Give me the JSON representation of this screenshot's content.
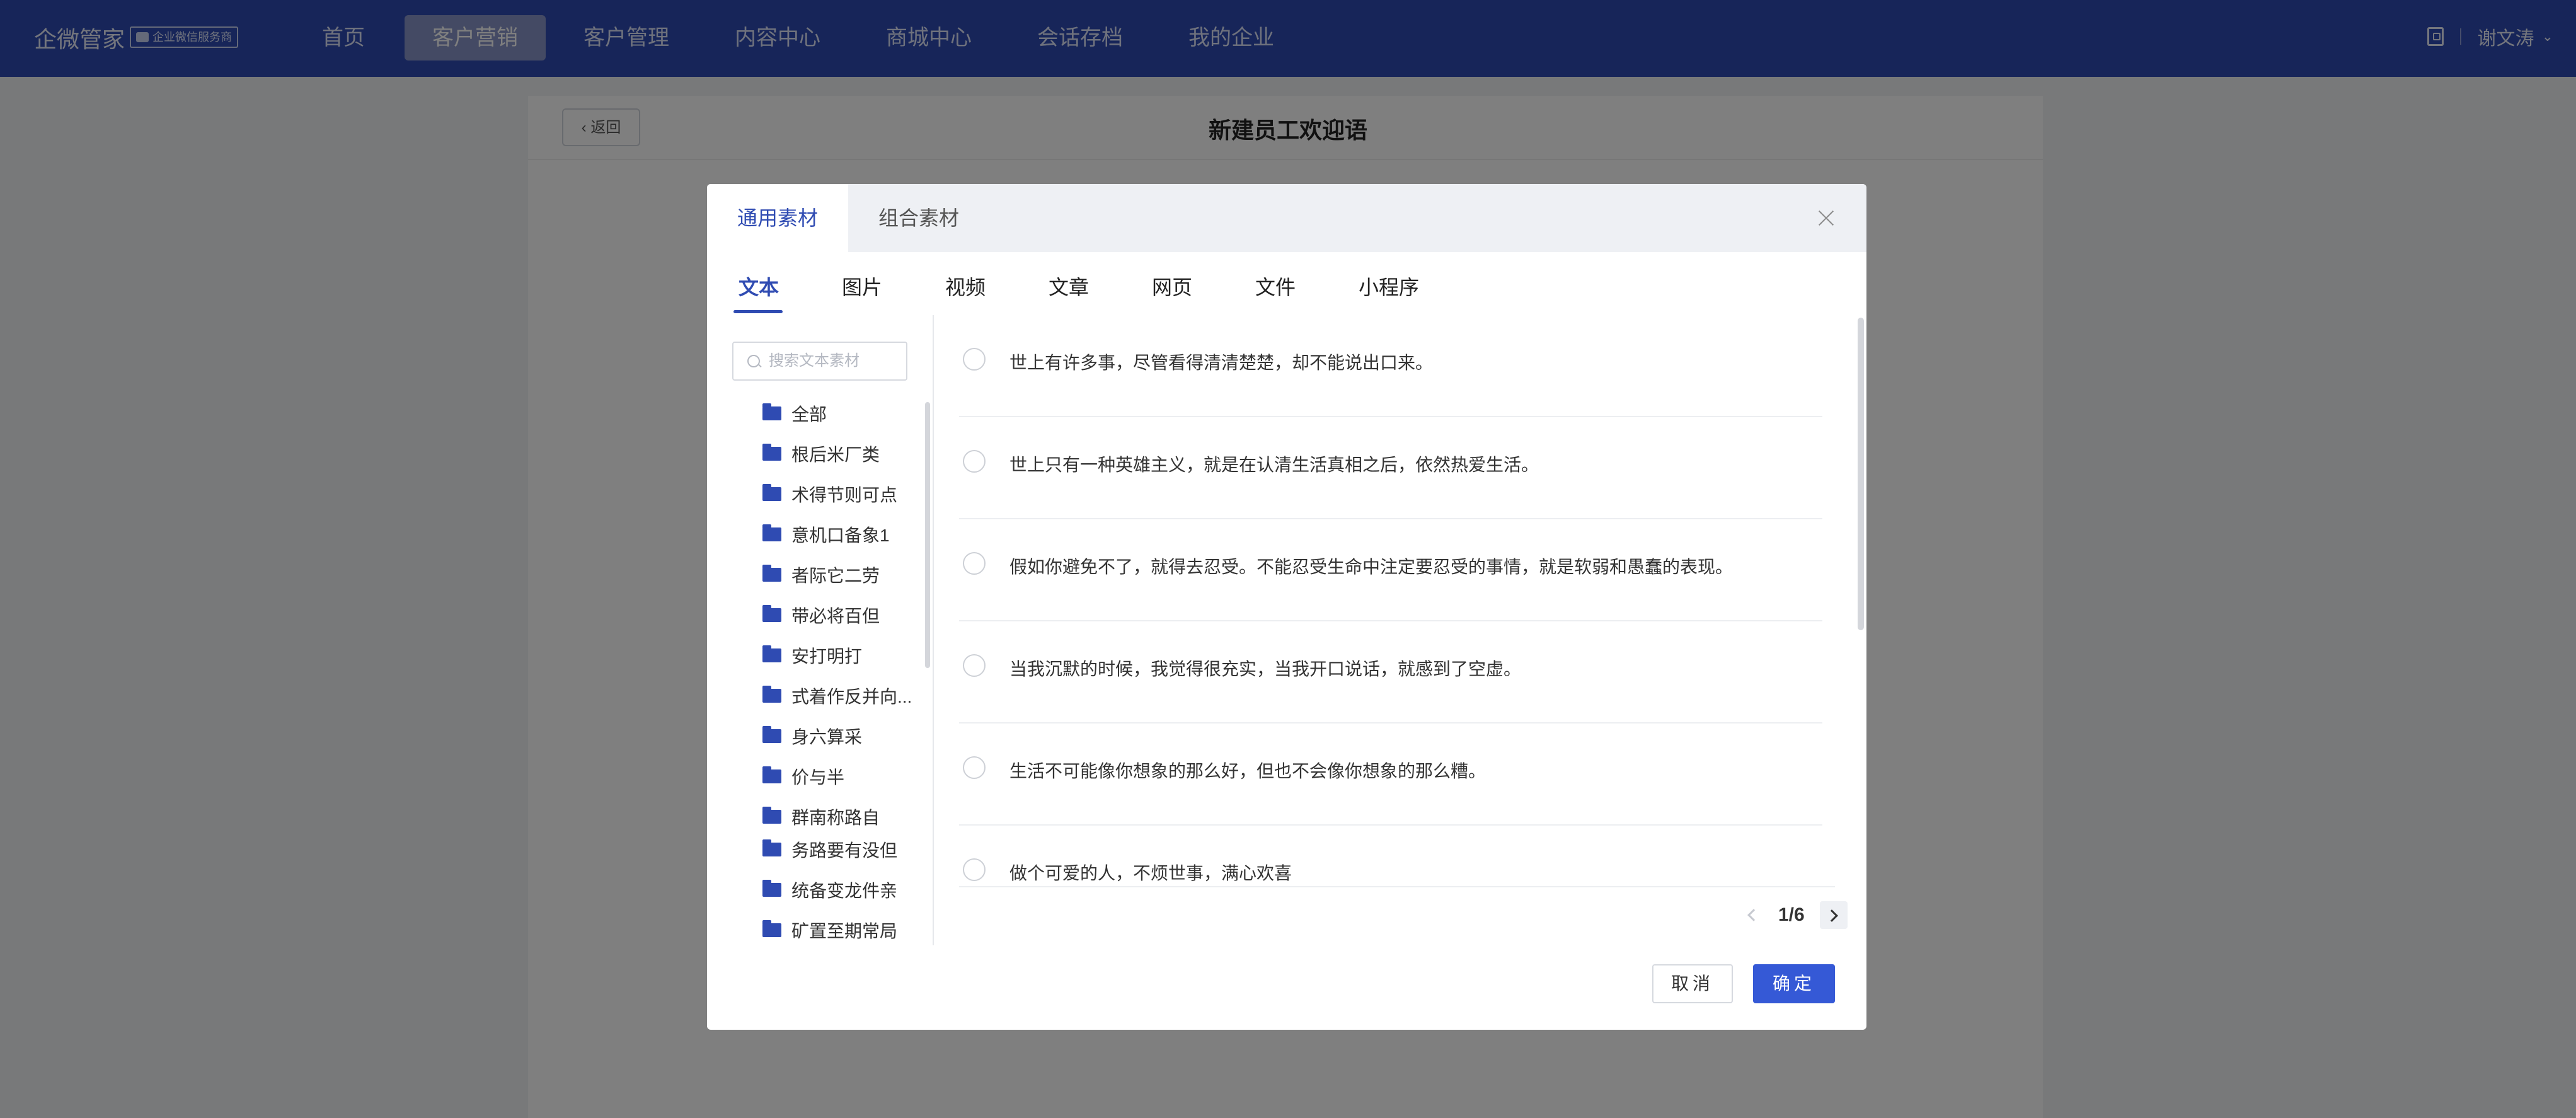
{
  "topbar": {
    "logo": "企微管家",
    "badge": "企业微信服务商",
    "nav": [
      {
        "label": "首页"
      },
      {
        "label": "客户营销"
      },
      {
        "label": "客户管理"
      },
      {
        "label": "内容中心"
      },
      {
        "label": "商城中心"
      },
      {
        "label": "会话存档"
      },
      {
        "label": "我的企业"
      }
    ],
    "active_nav": "客户营销",
    "user": "谢文涛"
  },
  "page": {
    "back_label": "返回",
    "title": "新建员工欢迎语"
  },
  "modal": {
    "tabs": [
      {
        "label": "通用素材"
      },
      {
        "label": "组合素材"
      }
    ],
    "active_tab": "通用素材",
    "content_tabs": [
      {
        "label": "文本"
      },
      {
        "label": "图片"
      },
      {
        "label": "视频"
      },
      {
        "label": "文章"
      },
      {
        "label": "网页"
      },
      {
        "label": "文件"
      },
      {
        "label": "小程序"
      }
    ],
    "active_content_tab": "文本",
    "search_placeholder": "搜索文本素材",
    "folders": [
      {
        "label": "全部"
      },
      {
        "label": "根后米厂类"
      },
      {
        "label": "术得节则可点"
      },
      {
        "label": "意机口备象1"
      },
      {
        "label": "者际它二劳"
      },
      {
        "label": "带必将百但"
      },
      {
        "label": "安打明打"
      },
      {
        "label": "式着作反并向..."
      },
      {
        "label": "身六算采"
      },
      {
        "label": "价与半"
      },
      {
        "label": "群南称路自"
      },
      {
        "label": "务路要有没但"
      },
      {
        "label": "统备变龙件亲"
      },
      {
        "label": "矿置至期常局"
      }
    ],
    "items": [
      {
        "text": "世上有许多事，尽管看得清清楚楚，却不能说出口来。"
      },
      {
        "text": "世上只有一种英雄主义，就是在认清生活真相之后，依然热爱生活。"
      },
      {
        "text": "假如你避免不了，就得去忍受。不能忍受生命中注定要忍受的事情，就是软弱和愚蠢的表现。"
      },
      {
        "text": "当我沉默的时候，我觉得很充实，当我开口说话，就感到了空虚。"
      },
      {
        "text": "生活不可能像你想象的那么好，但也不会像你想象的那么糟。"
      },
      {
        "text": "做个可爱的人，不烦世事，满心欢喜"
      }
    ],
    "pager": "1/6",
    "cancel_label": "取消",
    "ok_label": "确定"
  },
  "colors": {
    "brand": "#2f4bb2",
    "primary_button": "#3559d6"
  }
}
